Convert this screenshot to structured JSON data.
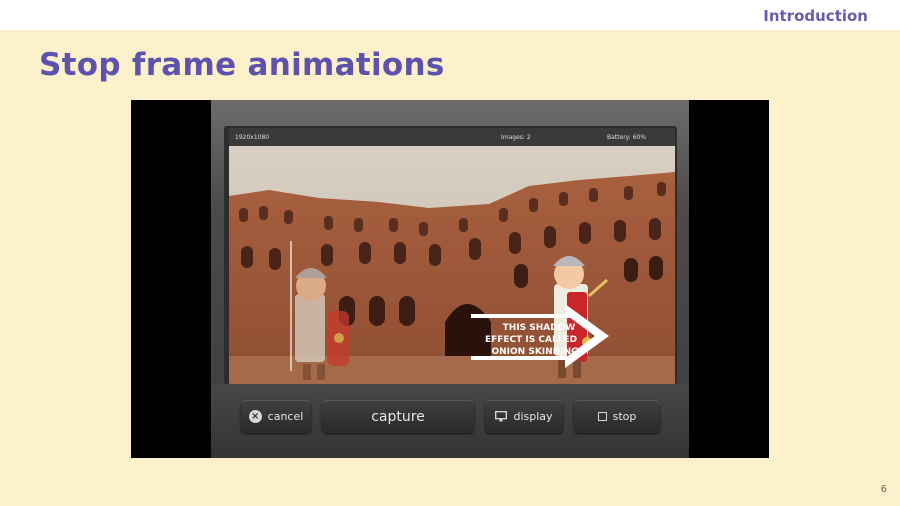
{
  "header": {
    "section_label": "Introduction"
  },
  "slide": {
    "title": "Stop frame animations",
    "page_number": "6"
  },
  "app": {
    "status": {
      "resolution": "1920x1080",
      "images": "Images: 2",
      "battery": "Battery: 60%"
    },
    "annotation": {
      "line1": "THIS SHADOW",
      "line2": "EFFECT IS CALLED",
      "line3": "ONION SKINNING"
    },
    "controls": {
      "cancel_label": "cancel",
      "capture_label": "capture",
      "display_label": "display",
      "stop_label": "stop"
    }
  },
  "colors": {
    "page_background": "#fdf1cb",
    "title_purple": "#5d52ad",
    "annotation_white": "#ffffff"
  }
}
